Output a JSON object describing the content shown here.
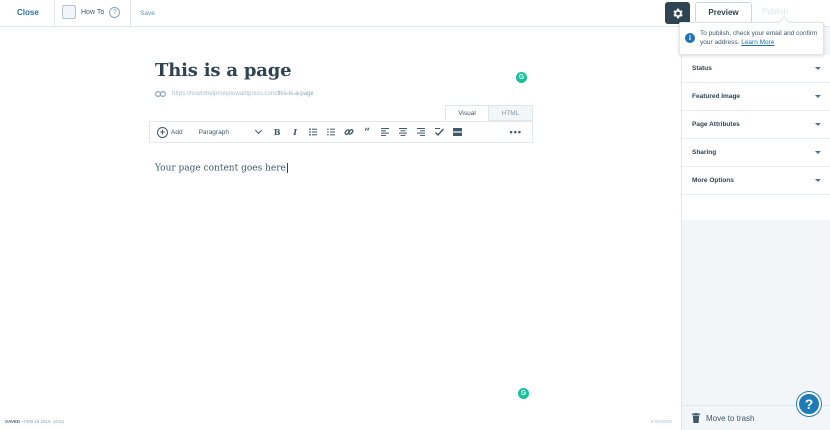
{
  "topbar": {
    "close_label": "Close",
    "site_name": "How To",
    "help_label": "?",
    "save_label": "Save",
    "preview_label": "Preview",
    "publish_label": "Publish"
  },
  "notice": {
    "text": "To publish, check your email and confirm your address.",
    "link_label": "Learn More"
  },
  "editor": {
    "title": "This is a page",
    "permalink_base": "https://howtohelpmeyouwantpress.com/",
    "permalink_slug": "this-is-a-page",
    "tabs": [
      "Visual",
      "HTML"
    ],
    "add_label": "Add",
    "format_value": "Paragraph",
    "content": "Your page content goes here"
  },
  "sidebar": {
    "sections": [
      {
        "label": "Status"
      },
      {
        "label": "Featured Image"
      },
      {
        "label": "Page Attributes"
      },
      {
        "label": "Sharing"
      },
      {
        "label": "More Options"
      }
    ],
    "trash_label": "Move to trash"
  },
  "footer": {
    "status": "SAVED",
    "timestamp": "• FEB 16 2019, 10:51",
    "word_count": "5 WORDS"
  },
  "colors": {
    "accent": "#2271b1",
    "grammarly": "#15c39a",
    "gear_bg": "#2e4453",
    "help_fab": "#1e7bb8"
  }
}
